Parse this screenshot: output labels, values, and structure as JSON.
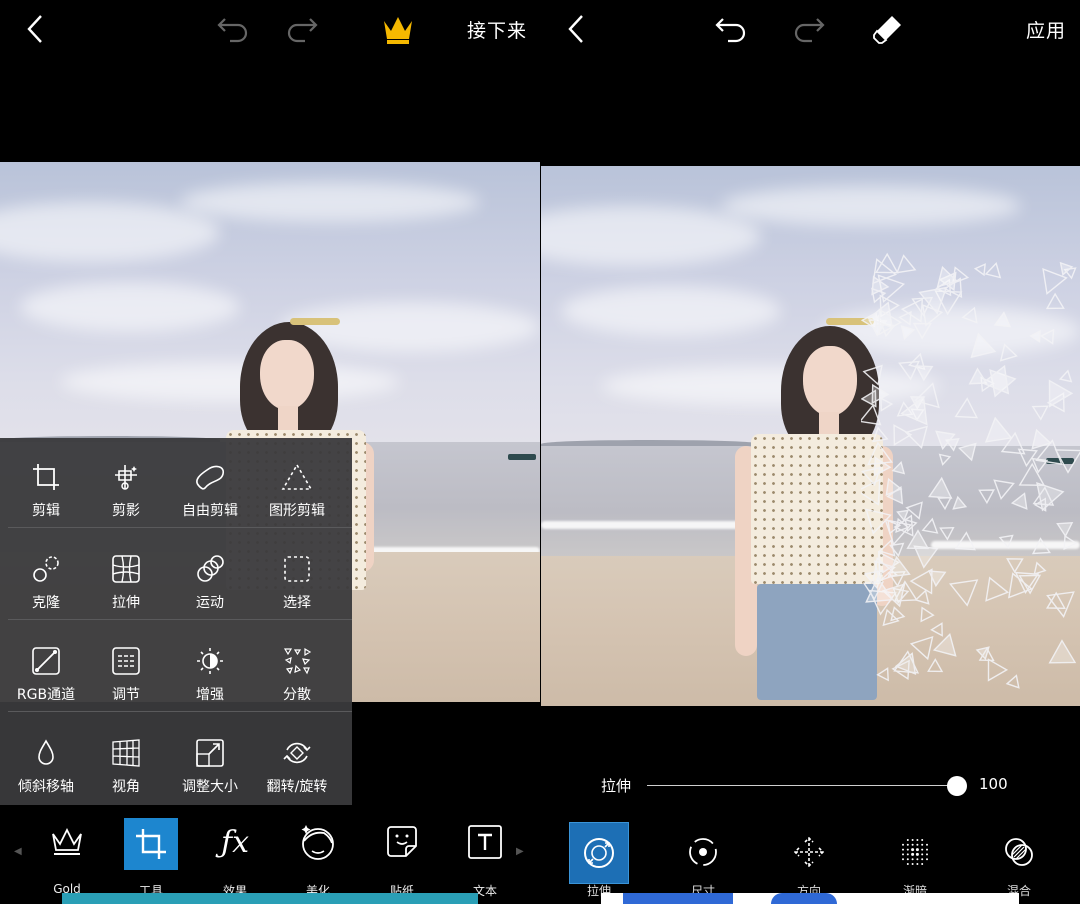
{
  "left": {
    "topbar": {
      "next_label": "接下来"
    },
    "tools": [
      [
        {
          "label": "剪辑",
          "icon": "crop-icon"
        },
        {
          "label": "剪影",
          "icon": "cutout-icon"
        },
        {
          "label": "自由剪辑",
          "icon": "free-crop-icon"
        },
        {
          "label": "图形剪辑",
          "icon": "shape-crop-icon"
        }
      ],
      [
        {
          "label": "克隆",
          "icon": "clone-icon"
        },
        {
          "label": "拉伸",
          "icon": "stretch-icon"
        },
        {
          "label": "运动",
          "icon": "motion-icon"
        },
        {
          "label": "选择",
          "icon": "select-icon"
        }
      ],
      [
        {
          "label": "RGB通道",
          "icon": "rgb-curve-icon"
        },
        {
          "label": "调节",
          "icon": "adjust-icon"
        },
        {
          "label": "增强",
          "icon": "enhance-icon"
        },
        {
          "label": "分散",
          "icon": "disperse-icon"
        }
      ],
      [
        {
          "label": "倾斜移轴",
          "icon": "tilt-shift-icon"
        },
        {
          "label": "视角",
          "icon": "perspective-icon"
        },
        {
          "label": "调整大小",
          "icon": "resize-icon"
        },
        {
          "label": "翻转/旋转",
          "icon": "flip-rotate-icon"
        }
      ]
    ],
    "bottombar": [
      {
        "label": "Gold",
        "icon": "crown-outline-icon"
      },
      {
        "label": "工具",
        "icon": "crop-tool-icon",
        "selected": true
      },
      {
        "label": "效果",
        "icon": "fx-icon"
      },
      {
        "label": "美化",
        "icon": "beautify-face-icon"
      },
      {
        "label": "贴纸",
        "icon": "sticker-icon"
      },
      {
        "label": "文本",
        "icon": "text-icon"
      }
    ]
  },
  "right": {
    "topbar": {
      "apply_label": "应用"
    },
    "slider": {
      "label": "拉伸",
      "value": "100",
      "fraction": 1.0
    },
    "bottombar": [
      {
        "label": "拉伸",
        "icon": "stretch-brush-icon",
        "selected": true
      },
      {
        "label": "尺寸",
        "icon": "size-icon"
      },
      {
        "label": "方向",
        "icon": "direction-icon"
      },
      {
        "label": "渐暗",
        "icon": "fade-icon"
      },
      {
        "label": "混合",
        "icon": "blend-icon"
      }
    ]
  },
  "colors": {
    "accent": "#1d86cf",
    "crown": "#f5b800",
    "panel": "#3a3a3c"
  }
}
